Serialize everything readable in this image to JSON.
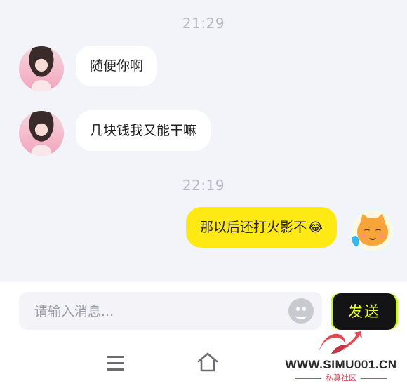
{
  "timestamps": [
    "21:29",
    "22:19"
  ],
  "messages": [
    {
      "sender": "other",
      "avatar": "girl-avatar",
      "text": "随便你啊"
    },
    {
      "sender": "other",
      "avatar": "girl-avatar",
      "text": "几块钱我又能干嘛"
    },
    {
      "sender": "self",
      "avatar": "cat-avatar",
      "text": "那以后还打火影不",
      "emoji": "😂"
    }
  ],
  "composer": {
    "placeholder": "请输入消息...",
    "send_label": "发送",
    "emoji_icon": "smiley-icon"
  },
  "navbar": {
    "icons": [
      "menu-icon",
      "home-icon"
    ]
  },
  "watermark": {
    "url": "WWW.SIMU001.CN",
    "sub": "私募社区"
  },
  "colors": {
    "self_bubble": "#ffe915",
    "send_bg": "#141416",
    "send_text": "#e6ff2a",
    "chat_bg": "#f3f3fa"
  }
}
